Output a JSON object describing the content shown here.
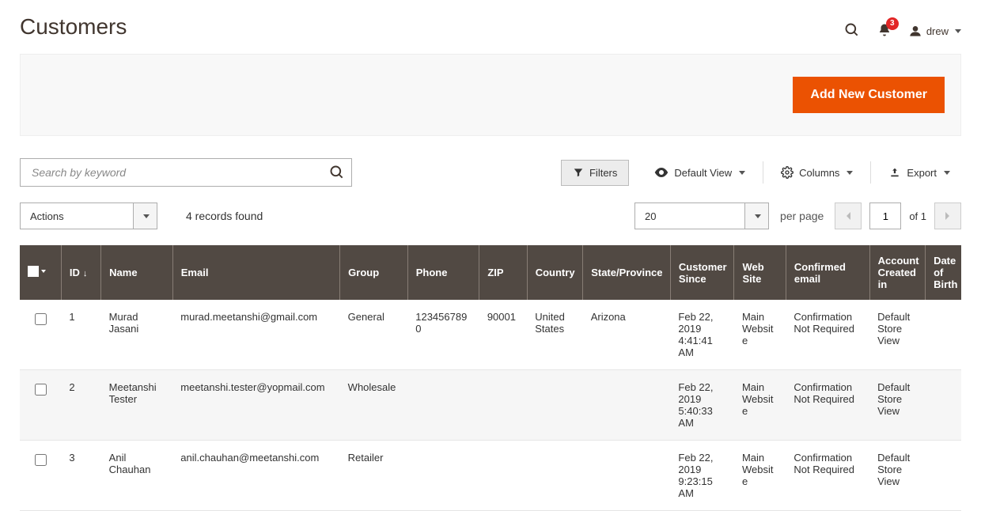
{
  "header": {
    "title": "Customers",
    "notification_count": "3",
    "username": "drew"
  },
  "actions": {
    "add_button": "Add New Customer"
  },
  "toolbar": {
    "search_placeholder": "Search by keyword",
    "filters_label": "Filters",
    "default_view_label": "Default View",
    "columns_label": "Columns",
    "export_label": "Export",
    "actions_label": "Actions",
    "records_found": "4 records found",
    "per_page_value": "20",
    "per_page_label": "per page",
    "page_current": "1",
    "page_of": "of 1"
  },
  "columns": {
    "id": "ID",
    "name": "Name",
    "email": "Email",
    "group": "Group",
    "phone": "Phone",
    "zip": "ZIP",
    "country": "Country",
    "state": "State/Province",
    "since": "Customer Since",
    "website": "Web Site",
    "confirmed": "Confirmed email",
    "created_in": "Account Created in",
    "dob": "Date of Birth"
  },
  "rows": [
    {
      "id": "1",
      "name": "Murad Jasani",
      "email": "murad.meetanshi@gmail.com",
      "group": "General",
      "phone": "1234567890",
      "zip": "90001",
      "country": "United States",
      "state": "Arizona",
      "since": "Feb 22, 2019 4:41:41 AM",
      "website": "Main Website",
      "confirmed": "Confirmation Not Required",
      "created_in": "Default Store View",
      "dob": ""
    },
    {
      "id": "2",
      "name": "Meetanshi Tester",
      "email": "meetanshi.tester@yopmail.com",
      "group": "Wholesale",
      "phone": "",
      "zip": "",
      "country": "",
      "state": "",
      "since": "Feb 22, 2019 5:40:33 AM",
      "website": "Main Website",
      "confirmed": "Confirmation Not Required",
      "created_in": "Default Store View",
      "dob": ""
    },
    {
      "id": "3",
      "name": "Anil Chauhan",
      "email": "anil.chauhan@meetanshi.com",
      "group": "Retailer",
      "phone": "",
      "zip": "",
      "country": "",
      "state": "",
      "since": "Feb 22, 2019 9:23:15 AM",
      "website": "Main Website",
      "confirmed": "Confirmation Not Required",
      "created_in": "Default Store View",
      "dob": ""
    }
  ]
}
